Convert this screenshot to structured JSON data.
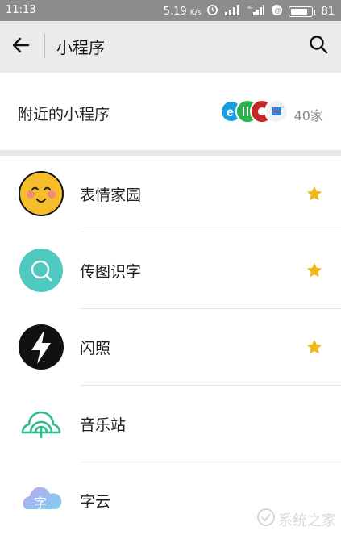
{
  "status_bar": {
    "time": "11:13",
    "speed": "5.19",
    "speed_unit": "K/s",
    "battery_level": "81",
    "battery_fraction": 0.81
  },
  "app_bar": {
    "title": "小程序",
    "back_icon": "arrow-left-icon",
    "search_icon": "search-icon"
  },
  "nearby": {
    "label": "附近的小程序",
    "count": "40家"
  },
  "apps": [
    {
      "name": "表情家园",
      "icon": "smiley-face-icon",
      "starred": true
    },
    {
      "name": "传图识字",
      "icon": "magnifier-circle-icon",
      "starred": true
    },
    {
      "name": "闪照",
      "icon": "lightning-bolt-icon",
      "starred": true
    },
    {
      "name": "音乐站",
      "icon": "music-station-icon",
      "starred": false
    },
    {
      "name": "字云",
      "icon": "word-cloud-icon",
      "starred": false
    }
  ],
  "colors": {
    "status_bar": "#8c8c8c",
    "app_bar": "#ebebeb",
    "star": "#f2b71c",
    "divider": "#e6e6e6"
  },
  "watermark": "系统之家"
}
